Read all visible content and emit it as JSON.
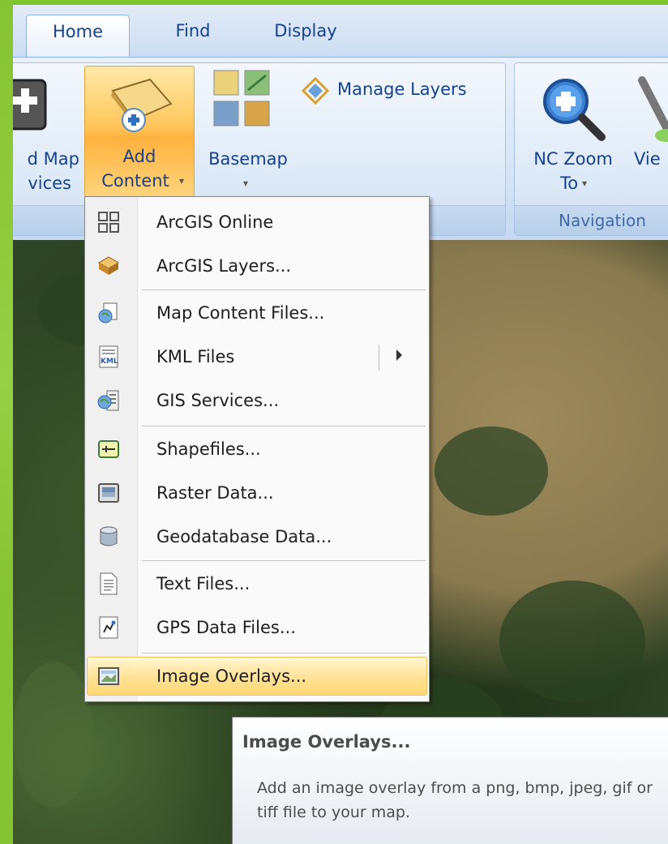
{
  "ribbon_tabs": [
    {
      "label": "Home",
      "active": true
    },
    {
      "label": "Find",
      "active": false
    },
    {
      "label": "Display",
      "active": false
    }
  ],
  "ribbon": {
    "add_map_services_partial_line1": "d Map",
    "add_map_services_partial_line2": "vices",
    "add_content_line1": "Add",
    "add_content_line2": "Content",
    "basemap_label": "Basemap",
    "manage_layers_label": "Manage Layers",
    "nc_zoom_line1": "NC Zoom",
    "nc_zoom_line2": "To",
    "view_partial_label": "Vie",
    "navigation_group_label": "Navigation"
  },
  "add_content_menu": {
    "items": [
      {
        "label": "ArcGIS Online",
        "icon": "arcgis-online-grid-icon"
      },
      {
        "label": "ArcGIS Layers...",
        "icon": "arcgis-layers-icon"
      },
      {
        "label": "Map Content Files...",
        "icon": "map-content-files-icon"
      },
      {
        "label": "KML Files",
        "icon": "kml-file-icon",
        "has_submenu": true
      },
      {
        "label": "GIS Services...",
        "icon": "gis-services-icon"
      },
      {
        "label": "Shapefiles...",
        "icon": "shapefile-icon"
      },
      {
        "label": "Raster Data...",
        "icon": "raster-data-icon"
      },
      {
        "label": "Geodatabase Data...",
        "icon": "geodatabase-icon"
      },
      {
        "label": "Text Files...",
        "icon": "text-file-icon"
      },
      {
        "label": "GPS Data Files...",
        "icon": "gps-data-icon"
      },
      {
        "label": "Image Overlays...",
        "icon": "image-overlay-icon",
        "highlighted": true
      }
    ]
  },
  "tooltip": {
    "title": "Image Overlays...",
    "body": "Add an image overlay from a png, bmp, jpeg, gif or tiff file to your map."
  },
  "colors": {
    "slide_green": "#7cc52a",
    "ribbon_text": "#15428b",
    "highlight": "#ffd874"
  }
}
